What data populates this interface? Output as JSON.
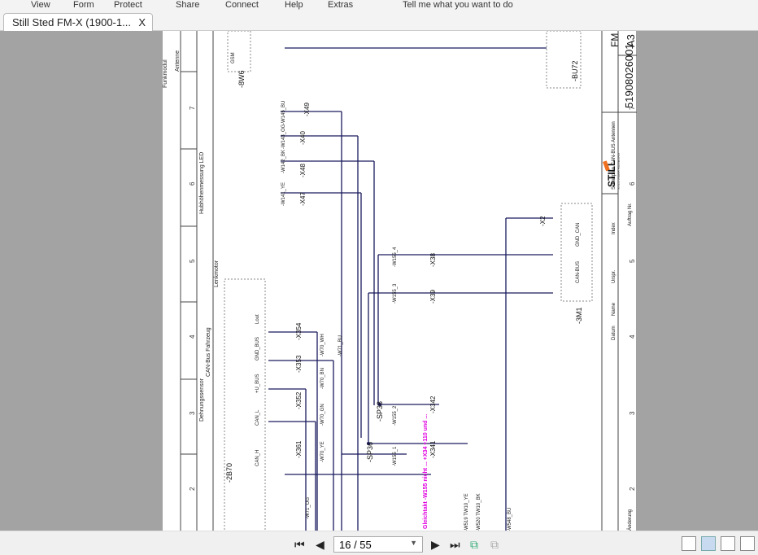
{
  "menu": [
    "View",
    "Form",
    "Protect",
    "Share",
    "Connect",
    "Help",
    "Extras",
    "Tell me what you want to do"
  ],
  "tab": {
    "title": "Still Sted FM-X (1900-1...",
    "close": "X"
  },
  "schematic": {
    "sections": [
      "Antenne",
      "Funkmodul",
      "Hubhöhenmessung LED",
      "Lenkmotor",
      "Dehnungssensor",
      "CAN-Bus Fahrzeug"
    ],
    "columns": [
      "7",
      "6",
      "5",
      "4",
      "3",
      "2"
    ],
    "devices": [
      "-8W6",
      "-BU72",
      "-2B70",
      "-3M1",
      "-SP38",
      "-SP36"
    ],
    "connectors": [
      "-X361",
      "-X352",
      "-X353",
      "-X354",
      "-X341",
      "-X342",
      "-X2",
      "-X49",
      "-X40",
      "-X48",
      "-X47",
      "-X38",
      "-X39"
    ],
    "wires": [
      "-W155_1",
      "-W155_2",
      "-W155_3",
      "-W155_4",
      "-W70_YE",
      "-W70_GN",
      "-W70_BN",
      "-W70_WH",
      "-W145_BU",
      "-W143_OG",
      "-W142_BK",
      "-W141_YE",
      "-W519 TW10_YE",
      "-W520 TW10_BK",
      "-W548_BU",
      "-W71_OG",
      "-W71_BU"
    ],
    "signals": [
      "CAN_H",
      "CAN_L",
      "+U_BUS",
      "GND_BUS",
      "Lout",
      "GND_CAN",
      "CAN-BUS",
      "GSM"
    ],
    "note": "Gleichtakt -W155 nicht ... +X34 +110 und ...",
    "title_block": {
      "drawing_no": "51908026001",
      "format": "A3",
      "sheet": "FM",
      "company": "STILL",
      "company_sub": "STILL GMBH HAMBURG",
      "order": "Auftrag Nr.",
      "desc": "Schaltplan CAN-BUS Antennen",
      "change": "Änderung",
      "date": "Datum",
      "name": "Name",
      "orig": "Urspr.",
      "index": "Index"
    }
  },
  "nav": {
    "page": "16 / 55"
  },
  "colors": {
    "wire": "#1a1a5e",
    "note": "#e000e0",
    "logo": "#f07020"
  }
}
